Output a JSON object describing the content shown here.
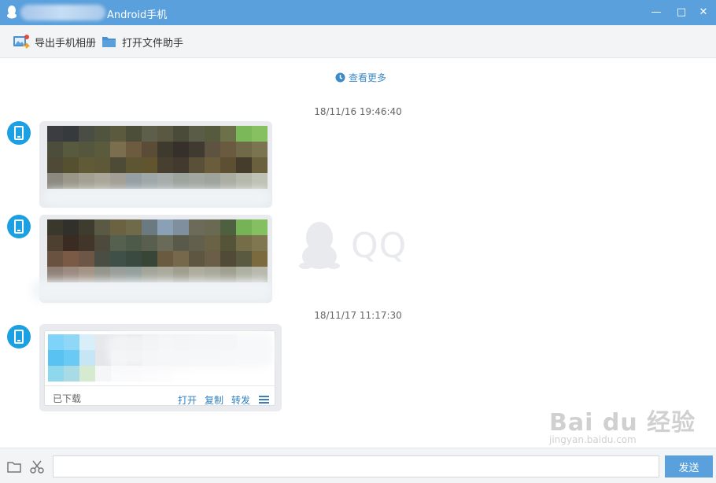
{
  "window": {
    "title": "Android手机",
    "minimize_glyph": "—",
    "maximize_glyph": "□",
    "close_glyph": "✕"
  },
  "toolbar": {
    "export_album_label": "导出手机相册",
    "open_file_assistant_label": "打开文件助手"
  },
  "chat": {
    "view_more_label": "查看更多",
    "watermark_text": "QQ",
    "messages": [
      {
        "timestamp": "18/11/16 19:46:40",
        "type": "image"
      },
      {
        "type": "image"
      },
      {
        "timestamp": "18/11/17 11:17:30",
        "type": "file",
        "status": "已下载",
        "actions": [
          "打开",
          "复制",
          "转发"
        ]
      }
    ]
  },
  "input": {
    "value": "",
    "send_label": "发送"
  },
  "overlay_watermark": {
    "main": "Bai du 经验",
    "sub": "jingyan.baidu.com"
  },
  "colors": {
    "titlebar": "#5aa0dc",
    "accent_link": "#2e7fc0",
    "avatar": "#1ba1e3",
    "bubble": "#e9ebee"
  },
  "icons": {
    "export_album": "photo-export-icon",
    "file_assistant": "folder-icon",
    "view_more": "clock-icon",
    "folder": "folder-icon",
    "screenshot": "scissors-icon"
  }
}
